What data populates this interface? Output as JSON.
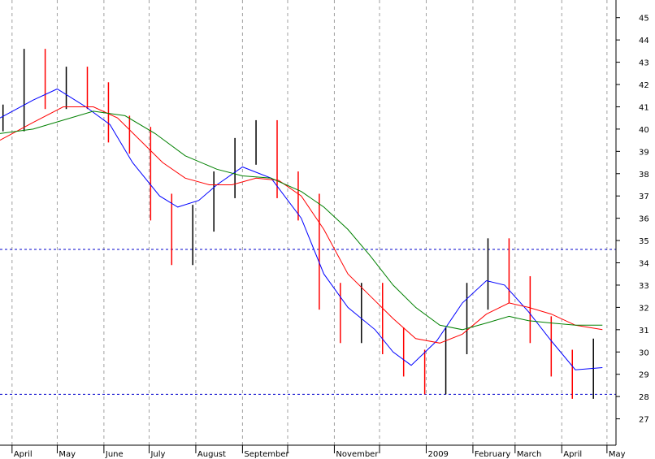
{
  "chart_data": {
    "type": "candlestick",
    "title": "",
    "xlabel": "",
    "ylabel": "",
    "ylim": [
      26,
      45.5
    ],
    "y_axis_position": "right",
    "yticks": [
      27,
      28,
      29,
      30,
      31,
      32,
      33,
      34,
      35,
      36,
      37,
      38,
      39,
      40,
      41,
      42,
      43,
      44,
      45
    ],
    "ytick_labels": [
      "27",
      "28",
      "29",
      "30",
      "31",
      "32",
      "33",
      "34",
      "35",
      "36",
      "37",
      "38",
      "39",
      "40",
      "41",
      "42",
      "43",
      "44",
      "45"
    ],
    "xlim": [
      "2008-03-24",
      "2009-05-07"
    ],
    "month_labels": [
      {
        "date": "2008-04-01",
        "label": "April"
      },
      {
        "date": "2008-05-01",
        "label": "May"
      },
      {
        "date": "2008-06-01",
        "label": "June"
      },
      {
        "date": "2008-07-01",
        "label": "July"
      },
      {
        "date": "2008-08-01",
        "label": "August"
      },
      {
        "date": "2008-09-01",
        "label": "September"
      },
      {
        "date": "2008-10-01",
        "label": ""
      },
      {
        "date": "2008-11-01",
        "label": "November"
      },
      {
        "date": "2008-12-01",
        "label": ""
      },
      {
        "date": "2009-01-01",
        "label": "2009"
      },
      {
        "date": "2009-02-01",
        "label": "February"
      },
      {
        "date": "2009-03-01",
        "label": "March"
      },
      {
        "date": "2009-04-01",
        "label": "April"
      },
      {
        "date": "2009-05-01",
        "label": "May"
      }
    ],
    "horizontal_lines": [
      {
        "y": 34.6,
        "color": "#0000cc",
        "style": "dashed"
      },
      {
        "y": 28.1,
        "color": "#0000cc",
        "style": "dashed"
      }
    ],
    "grid": {
      "vertical": true,
      "color": "#a0a0a0",
      "style": "dashed"
    },
    "candles": {
      "x": [
        "2008-03-26",
        "2008-04-09",
        "2008-04-23",
        "2008-05-07",
        "2008-05-21",
        "2008-06-04",
        "2008-06-18",
        "2008-07-02",
        "2008-07-16",
        "2008-07-30",
        "2008-08-13",
        "2008-08-27",
        "2008-09-10",
        "2008-09-24",
        "2008-10-08",
        "2008-10-22",
        "2008-11-05",
        "2008-11-19",
        "2008-12-03",
        "2008-12-17",
        "2008-12-31",
        "2009-01-14",
        "2009-01-28",
        "2009-02-11",
        "2009-02-25",
        "2009-03-11",
        "2009-03-25",
        "2009-04-08",
        "2009-04-22"
      ],
      "close": [
        40.5,
        43.0,
        41.5,
        42.2,
        41.5,
        40.0,
        39.5,
        36.5,
        34.5,
        36.0,
        37.5,
        39.0,
        39.8,
        37.5,
        36.5,
        32.5,
        31.0,
        32.5,
        30.5,
        29.5,
        28.7,
        30.5,
        32.5,
        34.5,
        32.8,
        31.0,
        29.5,
        28.5,
        30.0
      ],
      "up_color": "#000000",
      "down_color": "#ff0000"
    },
    "series": [
      {
        "color": "#0000ff",
        "x": [
          "2008-03-24",
          "2008-04-15",
          "2008-05-01",
          "2008-05-20",
          "2008-06-05",
          "2008-06-20",
          "2008-07-08",
          "2008-07-20",
          "2008-08-03",
          "2008-08-15",
          "2008-09-01",
          "2008-09-20",
          "2008-10-10",
          "2008-10-25",
          "2008-11-10",
          "2008-11-28",
          "2008-12-10",
          "2008-12-22",
          "2009-01-08",
          "2009-01-25",
          "2009-02-10",
          "2009-02-22",
          "2009-03-10",
          "2009-03-25",
          "2009-04-10",
          "2009-04-28"
        ],
        "values": [
          40.5,
          41.3,
          41.8,
          41.0,
          40.2,
          38.5,
          37.0,
          36.5,
          36.8,
          37.5,
          38.3,
          37.8,
          36.0,
          33.5,
          32.0,
          31.0,
          30.0,
          29.4,
          30.5,
          32.2,
          33.2,
          33.0,
          31.8,
          30.5,
          29.2,
          29.3
        ]
      },
      {
        "color": "#ff0000",
        "x": [
          "2008-03-24",
          "2008-04-15",
          "2008-05-05",
          "2008-05-25",
          "2008-06-10",
          "2008-06-25",
          "2008-07-10",
          "2008-07-25",
          "2008-08-10",
          "2008-08-25",
          "2008-09-10",
          "2008-09-25",
          "2008-10-10",
          "2008-10-25",
          "2008-11-10",
          "2008-11-25",
          "2008-12-10",
          "2008-12-25",
          "2009-01-10",
          "2009-01-25",
          "2009-02-10",
          "2009-02-25",
          "2009-03-10",
          "2009-03-25",
          "2009-04-10",
          "2009-04-28"
        ],
        "values": [
          39.5,
          40.3,
          41.0,
          41.0,
          40.5,
          39.5,
          38.5,
          37.8,
          37.5,
          37.5,
          37.8,
          37.7,
          37.0,
          35.5,
          33.5,
          32.5,
          31.5,
          30.6,
          30.4,
          30.8,
          31.7,
          32.2,
          32.0,
          31.7,
          31.2,
          31.0
        ]
      },
      {
        "color": "#008000",
        "x": [
          "2008-03-24",
          "2008-04-15",
          "2008-05-05",
          "2008-05-25",
          "2008-06-15",
          "2008-07-05",
          "2008-07-25",
          "2008-08-15",
          "2008-09-01",
          "2008-09-20",
          "2008-10-10",
          "2008-10-25",
          "2008-11-10",
          "2008-11-25",
          "2008-12-10",
          "2008-12-25",
          "2009-01-10",
          "2009-01-25",
          "2009-02-10",
          "2009-02-25",
          "2009-03-10",
          "2009-03-25",
          "2009-04-10",
          "2009-04-28"
        ],
        "values": [
          39.8,
          40.0,
          40.4,
          40.8,
          40.6,
          39.8,
          38.8,
          38.2,
          37.9,
          37.8,
          37.2,
          36.5,
          35.5,
          34.3,
          33.0,
          32.0,
          31.2,
          31.0,
          31.3,
          31.6,
          31.4,
          31.3,
          31.2,
          31.2
        ]
      }
    ]
  }
}
